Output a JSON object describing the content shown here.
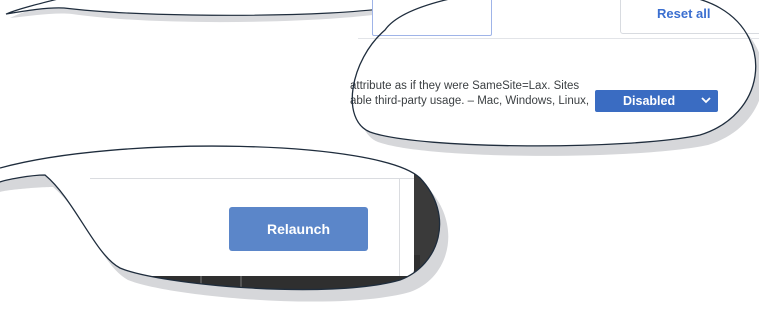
{
  "toolbar": {
    "reset_label": "Reset all"
  },
  "flag": {
    "description_line1": "attribute as if they were SameSite=Lax. Sites",
    "description_line2": "able third-party usage. – Mac, Windows, Linux,",
    "selected_value": "Disabled"
  },
  "footer": {
    "relaunch_label": "Relaunch"
  },
  "colors": {
    "accent": "#3a6cc2",
    "relaunch": "#5b86c9",
    "dark_window": "#3a3a3a"
  }
}
